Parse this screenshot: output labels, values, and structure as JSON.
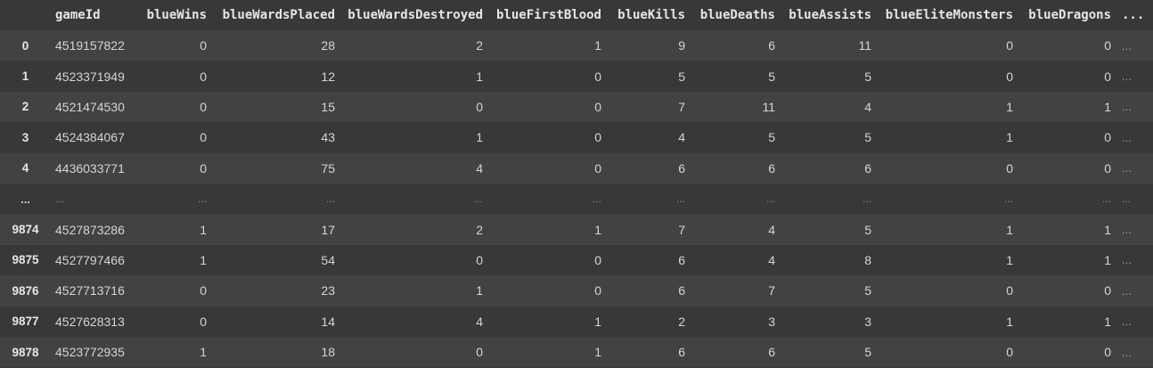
{
  "table": {
    "columns": [
      {
        "key": "gameId",
        "label": "gameId"
      },
      {
        "key": "blueWins",
        "label": "blueWins"
      },
      {
        "key": "blueWardsPlaced",
        "label": "blueWardsPlaced"
      },
      {
        "key": "blueWardsDestroyed",
        "label": "blueWardsDestroyed"
      },
      {
        "key": "blueFirstBlood",
        "label": "blueFirstBlood"
      },
      {
        "key": "blueKills",
        "label": "blueKills"
      },
      {
        "key": "blueDeaths",
        "label": "blueDeaths"
      },
      {
        "key": "blueAssists",
        "label": "blueAssists"
      },
      {
        "key": "blueEliteMonsters",
        "label": "blueEliteMonsters"
      },
      {
        "key": "blueDragons",
        "label": "blueDragons"
      },
      {
        "key": "more",
        "label": "..."
      }
    ],
    "rows": [
      {
        "index": "0",
        "values": [
          "4519157822",
          "0",
          "28",
          "2",
          "1",
          "9",
          "6",
          "11",
          "0",
          "0",
          "..."
        ]
      },
      {
        "index": "1",
        "values": [
          "4523371949",
          "0",
          "12",
          "1",
          "0",
          "5",
          "5",
          "5",
          "0",
          "0",
          "..."
        ]
      },
      {
        "index": "2",
        "values": [
          "4521474530",
          "0",
          "15",
          "0",
          "0",
          "7",
          "11",
          "4",
          "1",
          "1",
          "..."
        ]
      },
      {
        "index": "3",
        "values": [
          "4524384067",
          "0",
          "43",
          "1",
          "0",
          "4",
          "5",
          "5",
          "1",
          "0",
          "..."
        ]
      },
      {
        "index": "4",
        "values": [
          "4436033771",
          "0",
          "75",
          "4",
          "0",
          "6",
          "6",
          "6",
          "0",
          "0",
          "..."
        ]
      },
      {
        "index": "...",
        "values": [
          "...",
          "...",
          "...",
          "...",
          "...",
          "...",
          "...",
          "...",
          "...",
          "...",
          "..."
        ],
        "ellipsis": true
      },
      {
        "index": "9874",
        "values": [
          "4527873286",
          "1",
          "17",
          "2",
          "1",
          "7",
          "4",
          "5",
          "1",
          "1",
          "..."
        ]
      },
      {
        "index": "9875",
        "values": [
          "4527797466",
          "1",
          "54",
          "0",
          "0",
          "6",
          "4",
          "8",
          "1",
          "1",
          "..."
        ]
      },
      {
        "index": "9876",
        "values": [
          "4527713716",
          "0",
          "23",
          "1",
          "0",
          "6",
          "7",
          "5",
          "0",
          "0",
          "..."
        ]
      },
      {
        "index": "9877",
        "values": [
          "4527628313",
          "0",
          "14",
          "4",
          "1",
          "2",
          "3",
          "3",
          "1",
          "1",
          "..."
        ]
      },
      {
        "index": "9878",
        "values": [
          "4523772935",
          "1",
          "18",
          "0",
          "1",
          "6",
          "6",
          "5",
          "0",
          "0",
          "..."
        ]
      }
    ]
  },
  "colors": {
    "background": "#383838",
    "row_alt": "#424242",
    "text": "#d5d5d5",
    "header_text": "#e6e6e6"
  }
}
